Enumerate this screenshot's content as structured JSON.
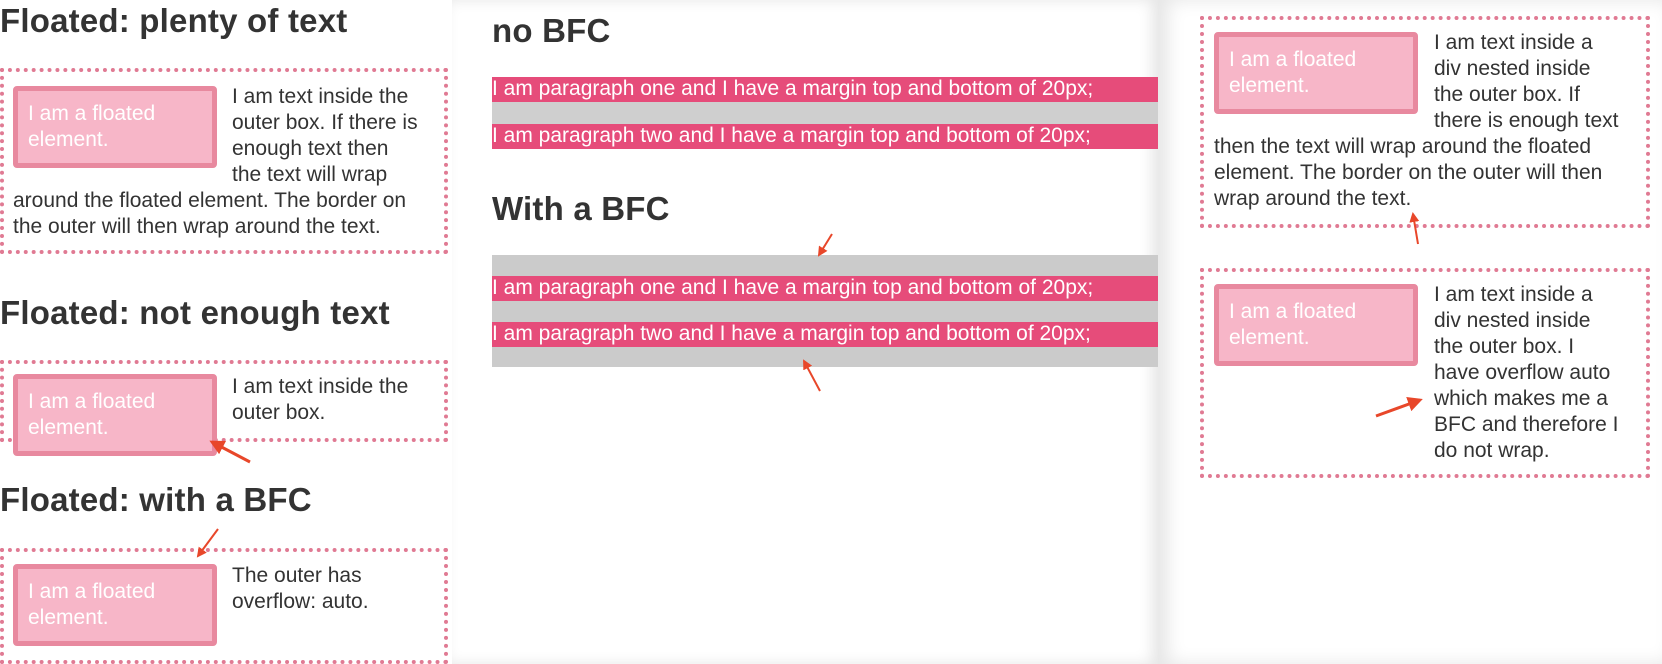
{
  "left": {
    "plenty": {
      "heading": "Floated: plenty of text",
      "float_label": "I am a floated element.",
      "lines": [
        "I am text inside the",
        "outer box. If there is",
        "enough text then",
        "the text will wrap",
        "around the floated element. The border on",
        "the outer will then wrap around the text."
      ]
    },
    "not_enough": {
      "heading": "Floated: not enough text",
      "float_label": "I am a floated element.",
      "lines": [
        "I am text inside the",
        "outer box."
      ]
    },
    "bfc": {
      "heading": "Floated: with a BFC",
      "float_label": "I am a floated element.",
      "lines": [
        "The outer has",
        "overflow: auto."
      ]
    }
  },
  "middle": {
    "no_bfc_heading": "no BFC",
    "with_bfc_heading": "With a BFC",
    "para_one": "I am paragraph one and I have a margin top and bottom of 20px;",
    "para_two": "I am paragraph two and I have a margin top and bottom of 20px;"
  },
  "right": {
    "top": {
      "float_label": "I am a floated element.",
      "lines": [
        "I am text inside a",
        "div nested inside",
        "the outer box. If",
        "there is enough text",
        "then the text will wrap around the floated",
        "element. The border on the outer will then",
        "wrap around the text."
      ]
    },
    "bottom": {
      "float_label": "I am a floated element.",
      "lines": [
        "I am text inside a",
        "div nested inside",
        "the outer box. I",
        "have overflow auto",
        "which makes me a",
        "BFC and therefore I",
        "do not wrap."
      ]
    }
  },
  "colors": {
    "float_fill": "#f7b6c8",
    "float_border": "#e8899f",
    "dotted_border": "#e07a93",
    "paragraph_bar": "#e64c7a",
    "grey_block": "#cbcbcb",
    "arrow": "#e8472a"
  }
}
